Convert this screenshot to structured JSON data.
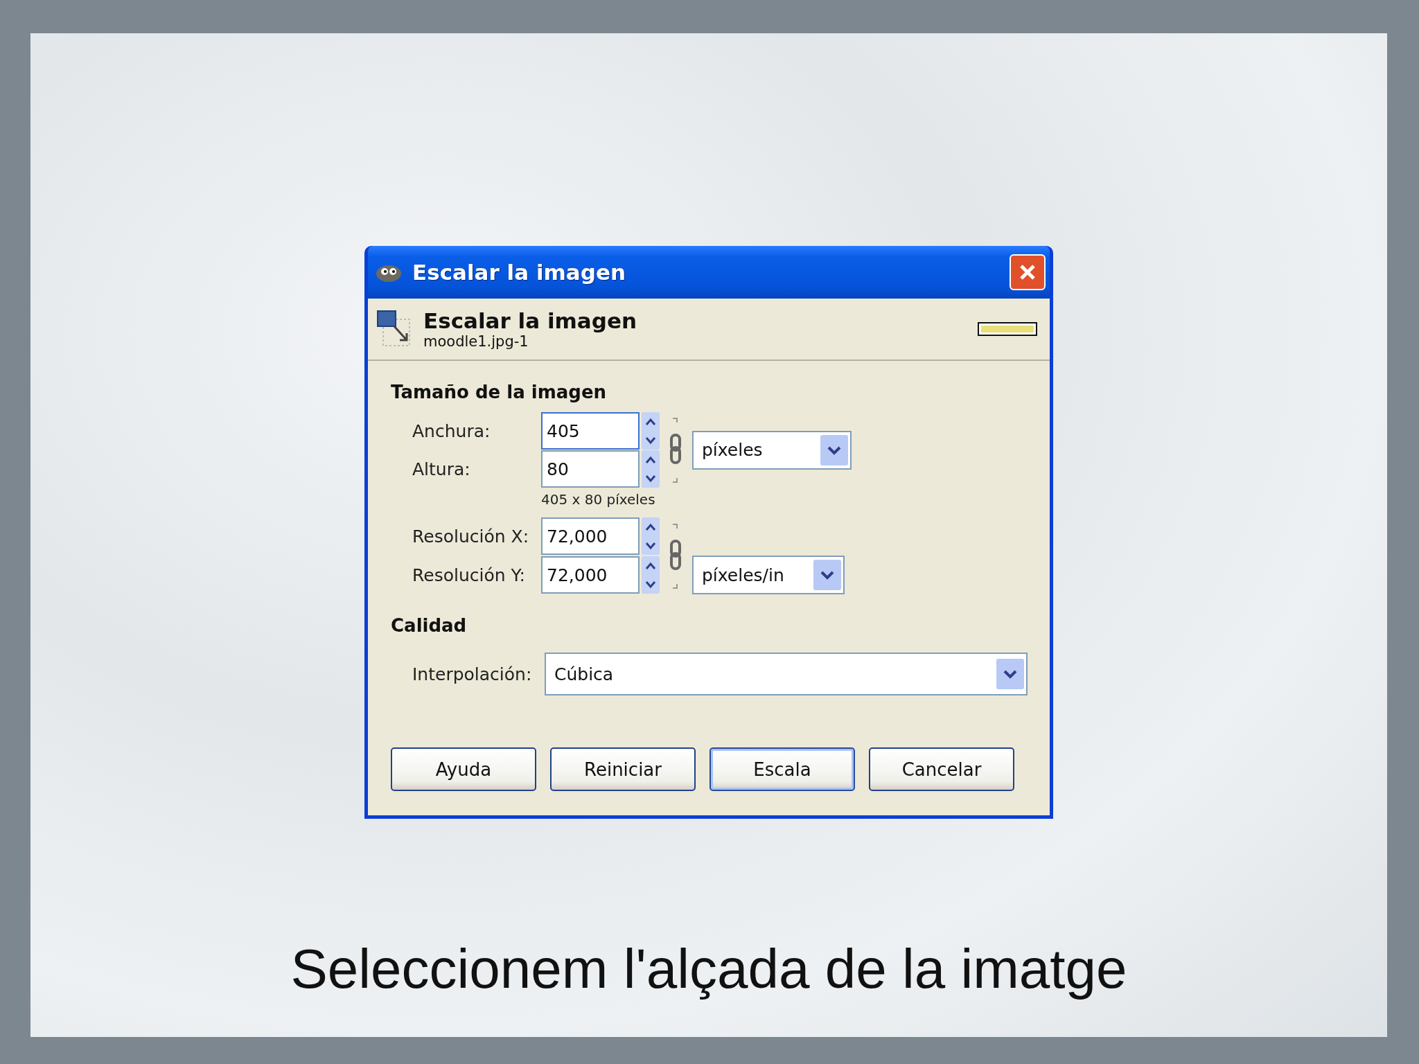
{
  "dialog": {
    "title": "Escalar la imagen",
    "header": {
      "title": "Escalar la imagen",
      "subtitle": "moodle1.jpg-1"
    },
    "size_section": {
      "title": "Tamaño de la imagen",
      "fields": [
        {
          "label": "Anchura:",
          "value": "405",
          "focused": true
        },
        {
          "label": "Altura:",
          "value": "80",
          "focused": false
        }
      ],
      "summary": "405 x 80 píxeles",
      "unit": "píxeles"
    },
    "resolution": {
      "fields": [
        {
          "label": "Resolución X:",
          "value": "72,000"
        },
        {
          "label": "Resolución Y:",
          "value": "72,000"
        }
      ],
      "unit": "píxeles/in"
    },
    "quality_section": {
      "title": "Calidad",
      "interpolation": {
        "label": "Interpolación:",
        "value": "Cúbica"
      }
    },
    "buttons": [
      {
        "label": "Ayuda",
        "default": false
      },
      {
        "label": "Reiniciar",
        "default": false
      },
      {
        "label": "Escala",
        "default": true
      },
      {
        "label": "Cancelar",
        "default": false
      }
    ]
  },
  "caption": "Seleccionem l'alçada de la imatge"
}
